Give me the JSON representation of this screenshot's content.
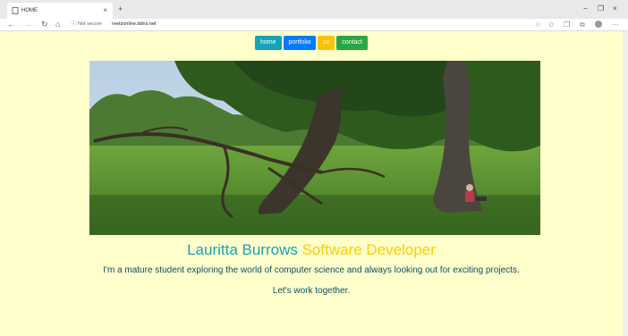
{
  "browser": {
    "tab_title": "HOME",
    "tab_close": "×",
    "new_tab": "+",
    "minimize": "−",
    "restore": "❐",
    "close": "×",
    "back": "←",
    "forward": "→",
    "refresh": "↻",
    "home": "⌂",
    "security_label": "ⓘ Not secure",
    "url": "reetzonline.ddns.net",
    "icons": [
      "star-icon",
      "favorites-icon",
      "collections-icon",
      "profile-icon",
      "more-icon"
    ]
  },
  "nav": {
    "items": [
      {
        "label": "home",
        "color": "#17a2b8"
      },
      {
        "label": "portfolio",
        "color": "#007bff"
      },
      {
        "label": "cv",
        "color": "#ffc107"
      },
      {
        "label": "contact",
        "color": "#28a745"
      }
    ]
  },
  "hero": {
    "image": "park-tree-photo"
  },
  "headline": {
    "name": "Lauritta Burrows",
    "role": "Software Developer"
  },
  "intro": "I'm a mature student exploring the world of computer science and always looking out for exciting projects.",
  "cta": "Let's work together.",
  "colors": {
    "page_background": "#ffffcc",
    "name": "#17a2b8",
    "role": "#ffcc00",
    "body_text": "#0b4f5f"
  }
}
